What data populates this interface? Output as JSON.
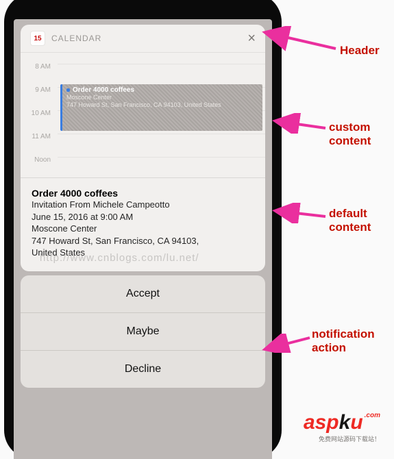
{
  "header": {
    "icon_day": "15",
    "title": "CALENDAR"
  },
  "timeline": {
    "hours": [
      "8 AM",
      "9 AM",
      "10 AM",
      "11 AM",
      "Noon"
    ],
    "event": {
      "title": "Order 4000 coffees",
      "location": "Moscone Center",
      "address": "747 Howard St, San Francisco, CA  94103, United States"
    }
  },
  "detail": {
    "title": "Order 4000 coffees",
    "invitation": "Invitation From Michele Campeotto",
    "datetime": "June 15, 2016 at 9:00 AM",
    "location": "Moscone Center",
    "address_line1": "747 Howard St, San Francisco, CA  94103,",
    "address_line2": "United States"
  },
  "actions": {
    "accept": "Accept",
    "maybe": "Maybe",
    "decline": "Decline"
  },
  "annotations": {
    "header": "Header",
    "custom": "custom content",
    "default": "default content",
    "action": "notification action"
  },
  "watermark": "http://www.cnblogs.com/lu.net/",
  "logo": {
    "main": "aspku",
    "suffix": ".com",
    "sub": "免费网站源码下载站！"
  }
}
